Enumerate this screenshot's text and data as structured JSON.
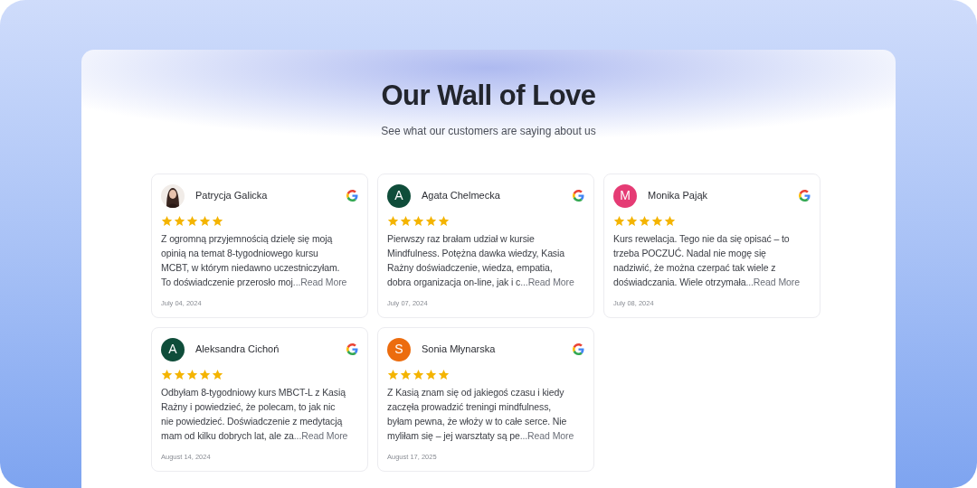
{
  "header": {
    "title": "Our Wall of Love",
    "subtitle": "See what our customers are saying about us"
  },
  "reviews": [
    {
      "name": "Patrycja Galicka",
      "avatar": {
        "kind": "picture"
      },
      "stars": 5,
      "lines": [
        "Z ogromną przyjemnością dzielę się moją",
        "opinią na temat 8-tygodniowego kursu",
        "MCBT, w którym niedawno uczestniczyłam.",
        "To doświadczenie przerosło moj"
      ],
      "more": "...Read More",
      "date": "July 04, 2024"
    },
    {
      "name": "Agata Chelmecka",
      "avatar": {
        "kind": "letter",
        "letter": "A",
        "color": "#0f4d3a"
      },
      "stars": 5,
      "lines": [
        "Pierwszy raz brałam udział w kursie",
        "Mindfulness. Potężna dawka wiedzy, Kasia",
        "Rażny doświadczenie, wiedza, empatia,",
        "dobra organizacja on-line, jak i c"
      ],
      "more": "...Read More",
      "date": "July 07, 2024"
    },
    {
      "name": "Monika Pająk",
      "avatar": {
        "kind": "letter",
        "letter": "M",
        "color": "#e53b74"
      },
      "stars": 5,
      "lines": [
        "Kurs rewelacja. Tego nie da się opisać – to",
        "trzeba POCZUĆ. Nadal nie mogę się",
        "nadziwić, że można czerpać tak wiele z",
        "doświadczania. Wiele otrzymała"
      ],
      "more": "...Read More",
      "date": "July 08, 2024"
    },
    {
      "name": "Aleksandra Cichoń",
      "avatar": {
        "kind": "letter",
        "letter": "A",
        "color": "#0f4d3a"
      },
      "stars": 5,
      "lines": [
        "Odbyłam 8-tygodniowy kurs MBCT-L z Kasią",
        "Rażny i powiedzieć, że polecam, to jak nic",
        "nie powiedzieć. Doświadczenie z medytacją",
        "mam od kilku dobrych lat, ale za"
      ],
      "more": "...Read More",
      "date": "August 14, 2024"
    },
    {
      "name": "Sonia Młynarska",
      "avatar": {
        "kind": "letter",
        "letter": "S",
        "color": "#ec6c0e"
      },
      "stars": 5,
      "lines": [
        "Z Kasią znam się od jakiegoś czasu i kiedy",
        "zaczęła prowadzić treningi mindfulness,",
        "byłam pewna, że włoży w to całe serce. Nie",
        "myliłam się – jej warsztaty są pe"
      ],
      "more": "...Read More",
      "date": "August 17, 2025"
    }
  ]
}
